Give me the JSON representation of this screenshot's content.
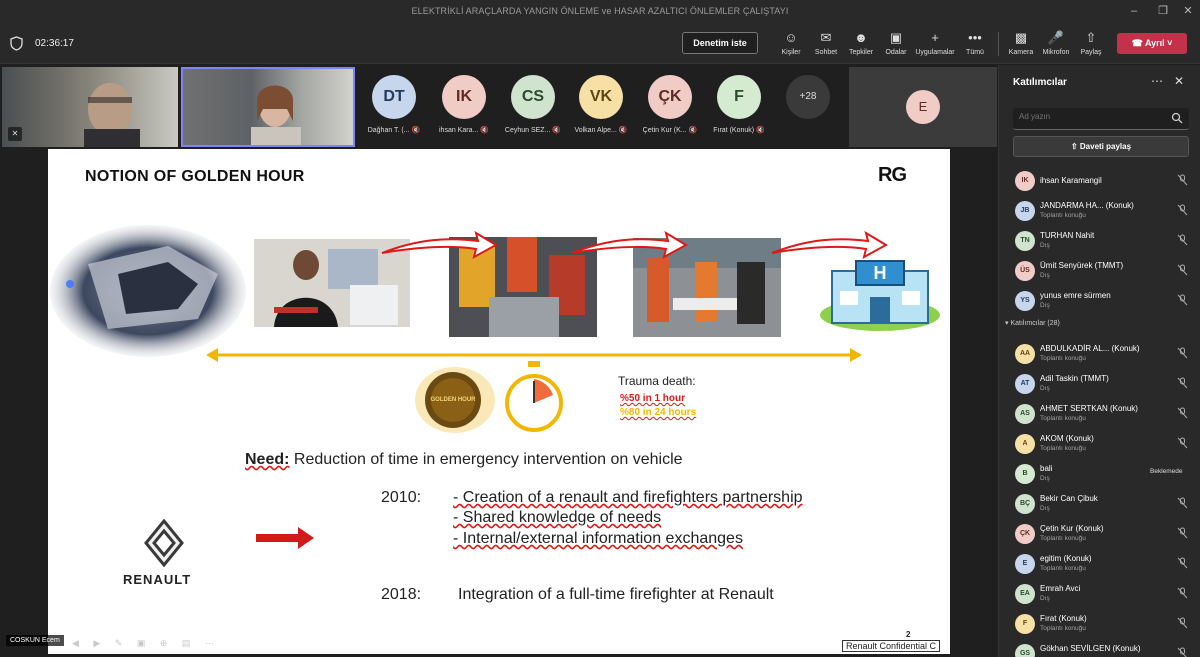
{
  "window": {
    "title": "ELEKTRİKLİ ARAÇLARDA YANGIN ÖNLEME ve HASAR AZALTICI ÖNLEMLER ÇALIŞTAYI"
  },
  "toolbar": {
    "timer": "02:36:17",
    "present_label": "Denetim iste",
    "items": [
      {
        "label": "Kişiler",
        "icon": "people-icon"
      },
      {
        "label": "Sohbet",
        "icon": "chat-icon"
      },
      {
        "label": "Tepkiler",
        "icon": "reactions-icon"
      },
      {
        "label": "Odalar",
        "icon": "rooms-icon"
      },
      {
        "label": "Uygulamalar",
        "icon": "apps-icon"
      },
      {
        "label": "Tümü",
        "icon": "more-icon"
      },
      {
        "label": "Kamera",
        "icon": "camera-off-icon"
      },
      {
        "label": "Mikrofon",
        "icon": "mic-off-icon"
      },
      {
        "label": "Paylaş",
        "icon": "share-screen-icon"
      }
    ],
    "leave_label": "Ayrıl",
    "leave_color": "#c4314b"
  },
  "gallery": {
    "tiles": [
      {
        "initials": "DT",
        "name": "Dağhan T. (...",
        "bg": "#c7d6ec",
        "fg": "#243a5e"
      },
      {
        "initials": "IK",
        "name": "ihsan Kara...",
        "bg": "#f1ccc6",
        "fg": "#5e2b26"
      },
      {
        "initials": "CS",
        "name": "Ceyhun SEZ...",
        "bg": "#cfe3cf",
        "fg": "#2c4a2c"
      },
      {
        "initials": "VK",
        "name": "Volkan Alpe...",
        "bg": "#f7e0a6",
        "fg": "#5e4612"
      },
      {
        "initials": "ÇK",
        "name": "Çetin Kur (K...",
        "bg": "#f1ccc6",
        "fg": "#5e2b26"
      },
      {
        "initials": "F",
        "name": "Fırat (Konuk)",
        "bg": "#d4ebd2",
        "fg": "#2c4a2c"
      }
    ],
    "more_count": "+28",
    "pinned_initial": "E"
  },
  "slide": {
    "title": "NOTION OF GOLDEN HOUR",
    "brand": "RG",
    "golden_hour_badge": "GOLDEN HOUR",
    "trauma_label": "Trauma death:",
    "trauma_1": "%50 in 1 hour",
    "trauma_2": "%80 in 24 hours",
    "need_label": "Need:",
    "need_text": " Reduction of time in emergency intervention on vehicle",
    "year_2010": "2010:",
    "bullet_1": "- Creation of a renault and firefighters partnership",
    "bullet_2": "- Shared knowledge of needs",
    "bullet_3": "- Internal/external information exchanges",
    "year_2018": "2018:",
    "text_2018": "Integration of a full-time firefighter at Renault",
    "renault_wordmark": "RENAULT",
    "page_number": "2",
    "confidential": "Renault Confidential C",
    "hospital_letter": "H"
  },
  "self_view": {
    "name": "COSKUN Ecem"
  },
  "panel": {
    "title": "Katılımcılar",
    "search_placeholder": "Ad yazın",
    "share_label": "Daveti paylaş",
    "section_label": "Katılımcılar (28)",
    "waiting": [
      {
        "initials": "IK",
        "name": "ihsan Karamangil",
        "status": "",
        "bg": "#f1ccc6",
        "fg": "#5e2b26"
      },
      {
        "initials": "JB",
        "name": "JANDARMA HA...  (Konuk)",
        "status": "Toplantı konuğu",
        "bg": "#c7d6ec",
        "fg": "#243a5e"
      },
      {
        "initials": "TN",
        "name": "TURHAN Nahit",
        "status": "Dış",
        "bg": "#cfe3cf",
        "fg": "#2c4a2c"
      },
      {
        "initials": "ÜS",
        "name": "Ümit Senyürek (TMMT)",
        "status": "Dış",
        "bg": "#f1ccc6",
        "fg": "#5e2b26"
      },
      {
        "initials": "YS",
        "name": "yunus emre sürmen",
        "status": "Dış",
        "bg": "#c7d6ec",
        "fg": "#243a5e"
      }
    ],
    "participants": [
      {
        "initials": "AA",
        "name": "ABDULKADİR AL...  (Konuk)",
        "status": "Toplantı konuğu",
        "bg": "#f7e0a6",
        "fg": "#5e4612"
      },
      {
        "initials": "AT",
        "name": "Adil Taskin (TMMT)",
        "status": "Dış",
        "bg": "#c7d6ec",
        "fg": "#243a5e"
      },
      {
        "initials": "AS",
        "name": "AHMET SERTKAN (Konuk)",
        "status": "Toplantı konuğu",
        "bg": "#cfe3cf",
        "fg": "#2c4a2c"
      },
      {
        "initials": "A",
        "name": "AKOM (Konuk)",
        "status": "Toplantı konuğu",
        "bg": "#f7e0a6",
        "fg": "#5e4612"
      },
      {
        "initials": "B",
        "name": "bali",
        "status": "Dış",
        "badge": "Beklemede",
        "bg": "#d4ebd2",
        "fg": "#2c4a2c"
      },
      {
        "initials": "BÇ",
        "name": "Bekir Can Çibuk",
        "status": "Dış",
        "bg": "#cfe3cf",
        "fg": "#2c4a2c"
      },
      {
        "initials": "ÇK",
        "name": "Çetin Kur (Konuk)",
        "status": "Toplantı konuğu",
        "bg": "#f1ccc6",
        "fg": "#5e2b26"
      },
      {
        "initials": "E",
        "name": "egitim (Konuk)",
        "status": "Toplantı konuğu",
        "bg": "#c7d6ec",
        "fg": "#243a5e"
      },
      {
        "initials": "EA",
        "name": "Emrah Avci",
        "status": "Dış",
        "bg": "#cfe3cf",
        "fg": "#2c4a2c"
      },
      {
        "initials": "F",
        "name": "Fırat (Konuk)",
        "status": "Toplantı konuğu",
        "bg": "#f7e0a6",
        "fg": "#5e4612"
      },
      {
        "initials": "GS",
        "name": "Gökhan SEVİLGEN (Konuk)",
        "status": "",
        "bg": "#cfe3cf",
        "fg": "#2c4a2c"
      }
    ]
  }
}
